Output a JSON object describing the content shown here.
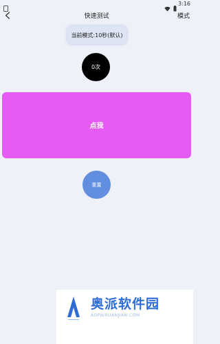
{
  "status_bar": {
    "time": "3:16"
  },
  "app_bar": {
    "title": "快速测试",
    "mode_label": "模式"
  },
  "mode_chip": {
    "text": "当前模式:10秒(默认)"
  },
  "counter": {
    "text": "0次"
  },
  "tap_area": {
    "label": "点我"
  },
  "reset_button": {
    "label": "重置"
  },
  "watermark": {
    "brand": "奥派软件园",
    "url": "AOPAIRUANJIAN.COM"
  },
  "colors": {
    "background": "#eef1f8",
    "tap_panel": "#e55bf3",
    "reset_button": "#628ee0",
    "counter_circle": "#000000",
    "mode_chip": "#dde4f3",
    "watermark_text": "#2e6dd6"
  },
  "icons": [
    "back-arrow-icon",
    "wifi-icon",
    "battery-icon",
    "status-app-icon"
  ]
}
